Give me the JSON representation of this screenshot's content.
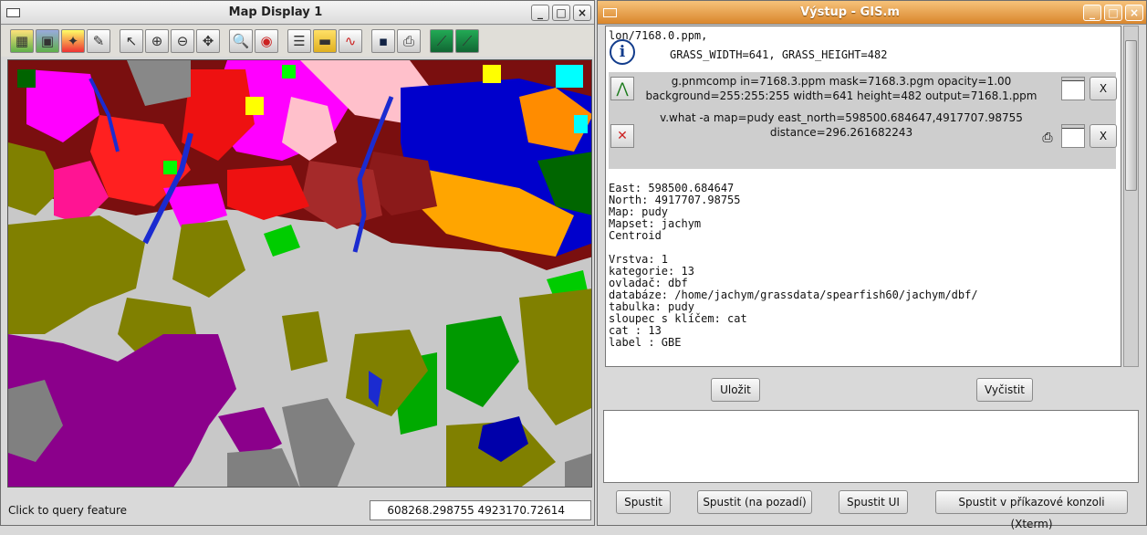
{
  "map_window": {
    "title": "Map Display 1",
    "minimize": "_",
    "maximize": "□",
    "close": "×",
    "status_text": "Click to query feature",
    "coords": "608268.298755 4923170.72614"
  },
  "toolbar_icons": [
    "display-map-icon",
    "display-overlays-icon",
    "render-icon",
    "erase-icon",
    "pointer-icon",
    "zoom-in-icon",
    "zoom-out-icon",
    "pan-icon",
    "zoom-back-icon",
    "zoom-menu-icon",
    "query-icon",
    "measure-icon",
    "profile-icon",
    "save-icon",
    "print-icon",
    "georect-icon",
    "nviz-icon"
  ],
  "output_window": {
    "title": "Výstup - GIS.m",
    "minimize": "_",
    "maximize": "□",
    "close": "×",
    "line1": "lon/7168.0.ppm,",
    "line2": "GRASS_WIDTH=641, GRASS_HEIGHT=482",
    "cmd1_line1": "g.pnmcomp in=7168.3.ppm mask=7168.3.pgm opacity=1.00",
    "cmd1_line2": "background=255:255:255 width=641 height=482 output=7168.1.ppm",
    "cmd2_line1": "v.what -a map=pudy east_north=598500.684647,4917707.98755",
    "cmd2_line2": "distance=296.261682243",
    "close_x": "X",
    "result_lines": [
      "East: 598500.684647",
      "North: 4917707.98755",
      "Map: pudy",
      "Mapset: jachym",
      "Centroid",
      "",
      "Vrstva: 1",
      "kategorie: 13",
      "ovladač: dbf",
      "databáze: /home/jachym/grassdata/spearfish60/jachym/dbf/",
      "tabulka: pudy",
      "sloupec s klíčem: cat",
      "cat : 13",
      "label : GBE"
    ],
    "save_button": "Uložit",
    "clear_button": "Vyčistit",
    "run_button": "Spustit",
    "run_bg_button": "Spustit (na pozadí)",
    "run_ui_button": "Spustit UI",
    "run_xterm_button": "Spustit v příkazové konzoli (Xterm)"
  }
}
